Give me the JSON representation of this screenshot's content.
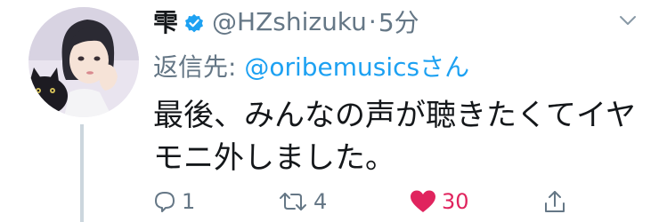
{
  "tweet": {
    "display_name": "雫",
    "handle": "@HZshizuku",
    "separator": "·",
    "time": "5分",
    "reply_prefix": "返信先: ",
    "reply_handle": "@oribemusics",
    "reply_suffix": "さん",
    "text": "最後、みんなの声が聴きたくてイヤモニ外しました。"
  },
  "actions": {
    "reply_count": "1",
    "retweet_count": "4",
    "like_count": "30"
  },
  "icons": {
    "verified": "verified-badge-icon",
    "caret": "chevron-down-icon",
    "reply": "reply-icon",
    "retweet": "retweet-icon",
    "like": "heart-icon",
    "share": "share-icon"
  },
  "colors": {
    "text": "#14171a",
    "secondary": "#657786",
    "link": "#1da1f2",
    "verified": "#1da1f2",
    "like": "#e0245e",
    "thread_line": "#ccd6dd"
  }
}
